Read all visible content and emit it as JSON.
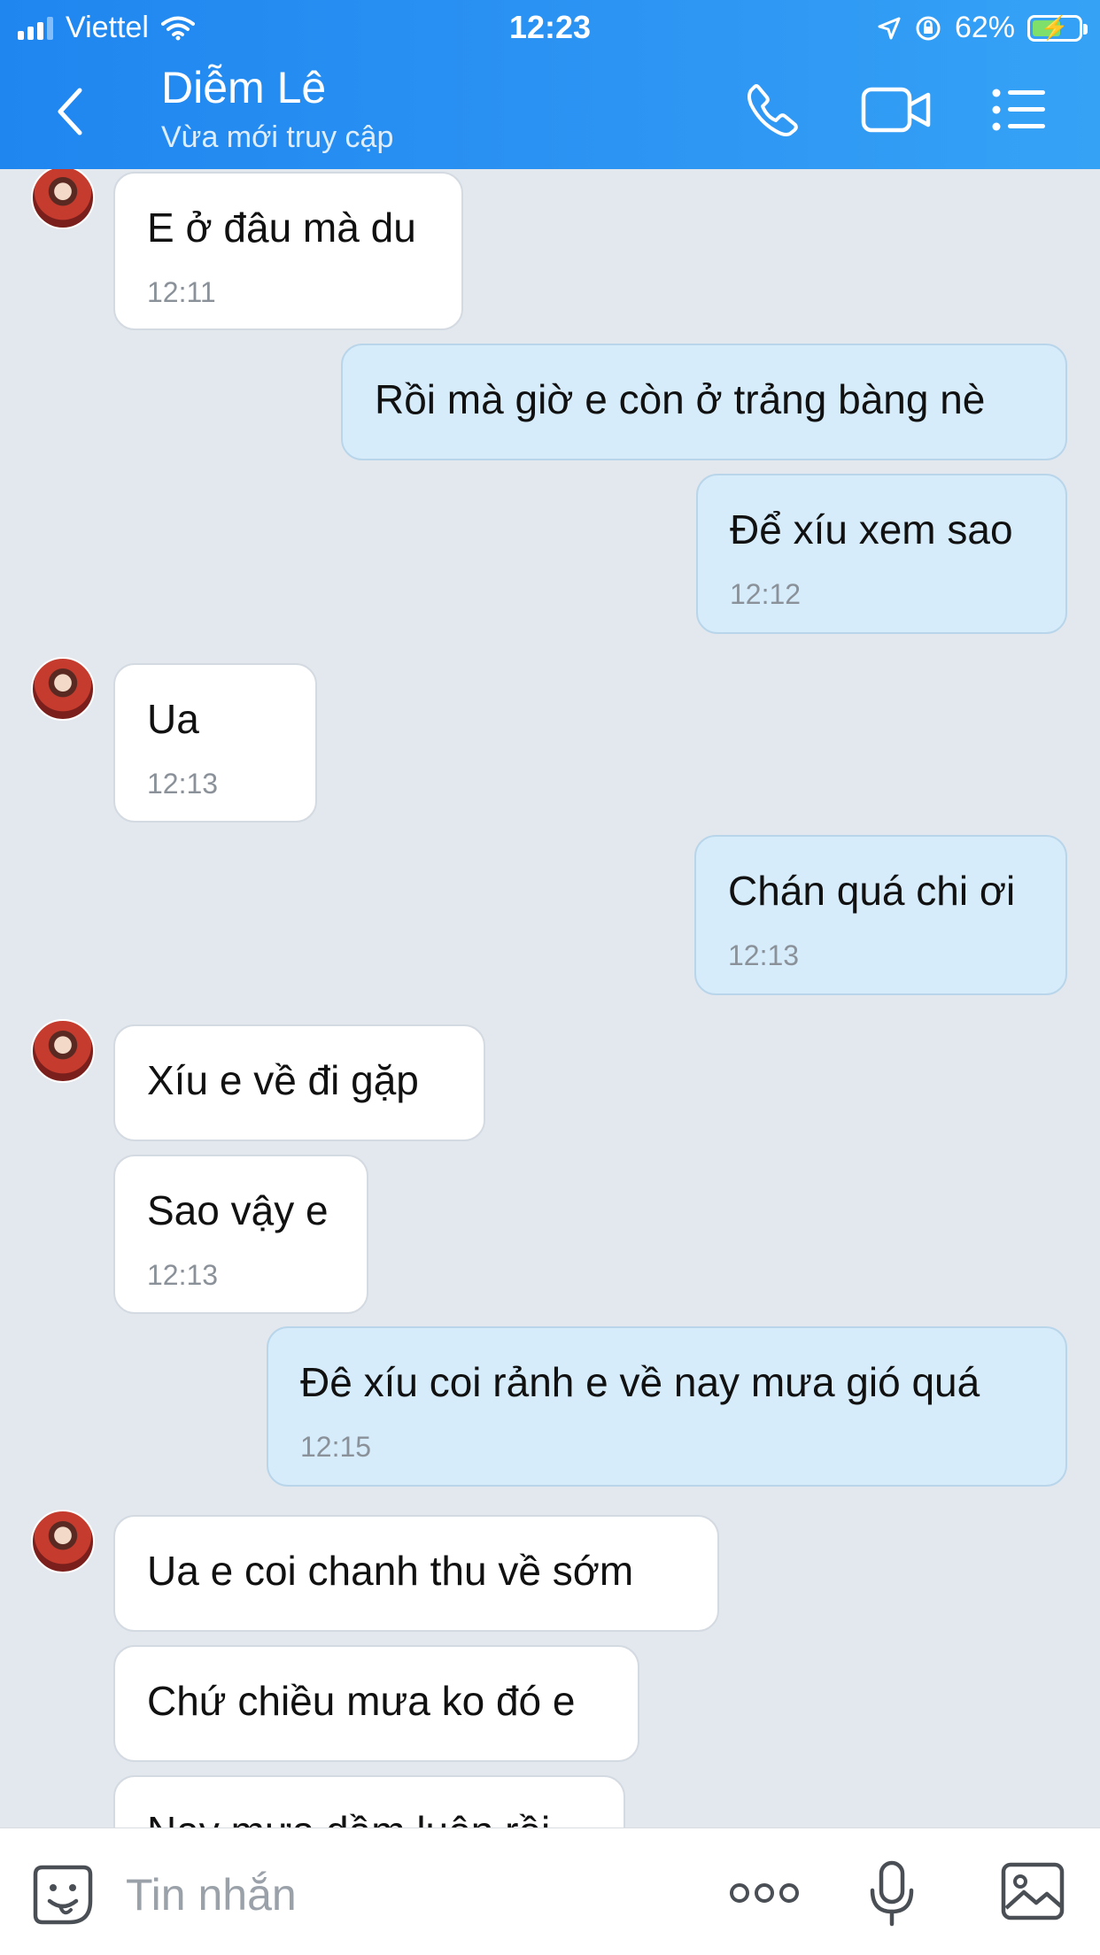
{
  "status_bar": {
    "carrier": "Viettel",
    "time": "12:23",
    "battery": "62%",
    "battery_level": 0.62
  },
  "header": {
    "contact_name": "Diễm Lê",
    "status": "Vừa mới truy cập",
    "icons": [
      "back-icon",
      "phone-icon",
      "video-call-icon",
      "menu-icon"
    ]
  },
  "messages": [
    {
      "side": "in",
      "text": "E ở đâu mà du",
      "time": "12:11",
      "avatar": true
    },
    {
      "side": "out",
      "text": "Rồi mà giờ e còn ở trảng bàng nè",
      "time": ""
    },
    {
      "side": "out",
      "text": "Để xíu xem sao",
      "time": "12:12"
    },
    {
      "side": "in",
      "text": "Ua",
      "time": "12:13",
      "avatar": true
    },
    {
      "side": "out",
      "text": "Chán quá chi ơi",
      "time": "12:13"
    },
    {
      "side": "in",
      "text": "Xíu e về đi gặp",
      "time": "",
      "avatar": true
    },
    {
      "side": "in",
      "text": "Sao vậy e",
      "time": "12:13"
    },
    {
      "side": "out",
      "text": "Đê xíu coi rảnh e về nay mưa gió quá",
      "time": "12:15"
    },
    {
      "side": "in",
      "text": "Ua e coi chanh thu về sớm",
      "time": "",
      "avatar": true
    },
    {
      "side": "in",
      "text": "Chứ chiều mưa ko đó e",
      "time": ""
    },
    {
      "side": "in",
      "text": "Nay mưa dầm luôn rồi",
      "time": ""
    }
  ],
  "input_bar": {
    "placeholder": "Tin nhắn",
    "icons": [
      "sticker-icon",
      "more-icon",
      "microphone-icon",
      "image-icon"
    ]
  },
  "colors": {
    "header": "#2d95f3",
    "background": "#e3e8ee",
    "incoming_bubble": "#ffffff",
    "outgoing_bubble": "#d6ecfb"
  }
}
